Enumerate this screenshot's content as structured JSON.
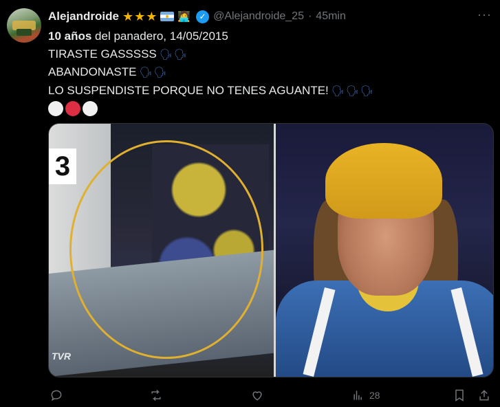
{
  "post": {
    "author": {
      "name": "Alejandroide",
      "handle": "@Alejandroide_25",
      "badges": [
        "star",
        "star",
        "star",
        "argentina-flag",
        "technologist",
        "apple",
        "verified"
      ]
    },
    "timestamp": "45min",
    "separator": "·",
    "lines": {
      "l1_bold": "10 años",
      "l1_rest": " del panadero, 14/05/2015",
      "l2": "TIRASTE GASSSSS",
      "l3": "ABANDONASTE",
      "l4": "LO SUSPENDISTE PORQUE NO TENES AGUANTE!"
    },
    "emoji": {
      "speaking_head_x2": "🗣🗣",
      "speaking_head_x3": "🗣🗣🗣",
      "stars": "★★★",
      "technologist": "🧑‍💻",
      "apple": ""
    },
    "circles": [
      "white",
      "red",
      "white"
    ],
    "media": {
      "left_overlay_number": "3",
      "left_overlay_logo": "TVR"
    },
    "stats": {
      "views": "28"
    }
  },
  "colors": {
    "background": "#000000",
    "text": "#e7e9ea",
    "secondary": "#71767b",
    "verified": "#1d9bf0",
    "star": "#f4b400",
    "ellipse": "#e0b030"
  }
}
